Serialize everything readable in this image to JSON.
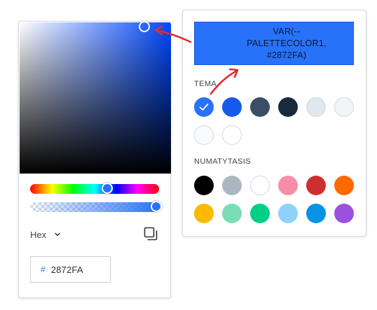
{
  "picker": {
    "format_label": "Hex",
    "hex_prefix": "#",
    "hex_value": "2872FA",
    "hue_level_pct": 61,
    "alpha_level_pct": 100
  },
  "palette": {
    "preview_text": "VAR(--PALETTECOLOR1, #2872FA)",
    "preview_color": "#2872FA",
    "theme_label": "TEMA",
    "default_label": "NUMATYTASIS",
    "theme_colors": [
      "#2872FA",
      "#1559ED",
      "#3A4F66",
      "#192A3D",
      "#E1E8ED",
      "#F2F5F7",
      "#FAFBFC",
      "#FFFFFF"
    ],
    "selected_theme_index": 0,
    "default_colors": [
      "#000000",
      "#ABB8C3",
      "#FFFFFF",
      "#F78DA7",
      "#CF2E2E",
      "#FF6900",
      "#FCB900",
      "#7BDCB5",
      "#00D084",
      "#8ED1FC",
      "#0693E3",
      "#9B51E0"
    ]
  },
  "icons": {
    "format_dropdown": "chevron-down-icon",
    "copy": "copy-icon",
    "selected": "checkmark-icon"
  },
  "annotation_color": "#E02B2B"
}
